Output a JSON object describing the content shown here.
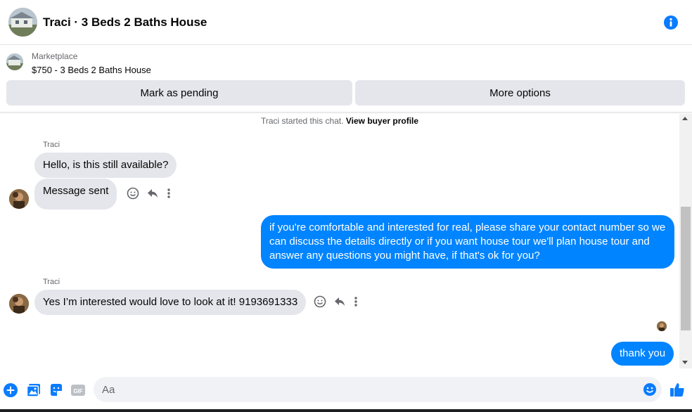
{
  "header": {
    "title": "Traci · 3 Beds 2 Baths House",
    "info_icon": "info-icon"
  },
  "listing": {
    "source": "Marketplace",
    "title": "$750 - 3 Beds 2 Baths House",
    "mark_pending_label": "Mark as pending",
    "more_options_label": "More options"
  },
  "chat": {
    "started_text": "Traci started this chat.",
    "view_profile_label": "View buyer profile",
    "messages": [
      {
        "sender": "Traci",
        "text": "Hello, is this still available?"
      },
      {
        "sender": "",
        "text": "Message sent"
      },
      {
        "sender": "me",
        "text": "if you're comfortable and interested for real, please share your contact number so we can discuss the details directly or if you want house tour we'll plan house tour and answer any questions you might have, if that's ok for you?"
      },
      {
        "sender": "Traci",
        "text": "Yes I’m interested would love to look at it! 9193691333"
      },
      {
        "sender": "me",
        "text": "thank you"
      }
    ]
  },
  "composer": {
    "placeholder": "Aa"
  },
  "colors": {
    "accent": "#0084ff",
    "bubble_in": "#e4e6eb",
    "icon_blue": "#0a7cff"
  }
}
